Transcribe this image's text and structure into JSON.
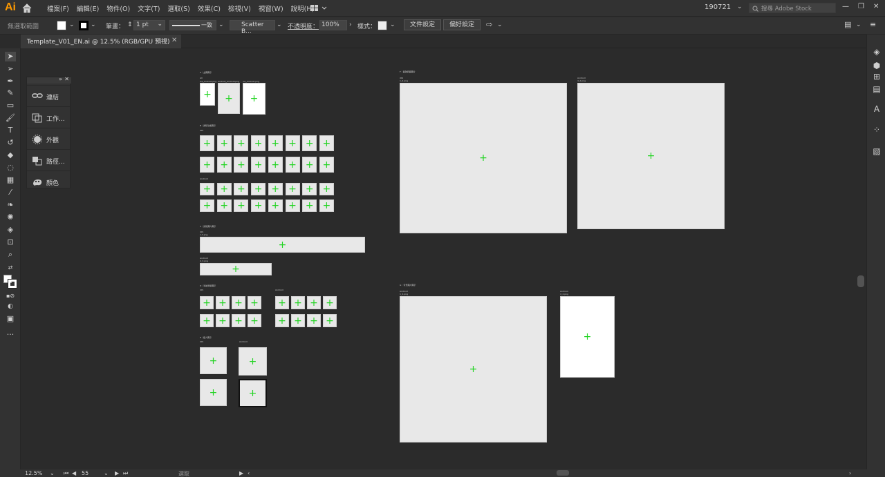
{
  "app": {
    "logo": "Ai",
    "date_badge": "190721",
    "stock_placeholder": "搜尋 Adobe Stock"
  },
  "menu": [
    "檔案(F)",
    "編輯(E)",
    "物件(O)",
    "文字(T)",
    "選取(S)",
    "效果(C)",
    "檢視(V)",
    "視窗(W)",
    "說明(H)"
  ],
  "control": {
    "selection": "無選取範圍",
    "stroke_label": "筆畫：",
    "stroke_weight": "1 pt",
    "stroke_profile": "一致",
    "brush": "Scatter B...",
    "opacity_label": "不透明度：",
    "opacity": "100%",
    "style_label": "樣式：",
    "doc_setup": "文件設定",
    "preferences": "偏好設定"
  },
  "tab": {
    "title": "Template_V01_EN.ai @ 12.5% (RGB/GPU 預視)",
    "close": "✕"
  },
  "panel_items": [
    {
      "label": "連結",
      "icon": "link-icon"
    },
    {
      "label": "工作...",
      "icon": "artboards-icon"
    },
    {
      "label": "外觀",
      "icon": "appearance-icon"
    },
    {
      "label": "路徑...",
      "icon": "pathfinder-icon"
    },
    {
      "label": "顏色",
      "icon": "color-icon"
    }
  ],
  "status": {
    "zoom": "12.5%",
    "artboard": "55",
    "tool": "選取"
  },
  "canvas_labels": {
    "sec_a": "A｜主圖圖示",
    "a_l1": "All",
    "a_l2": "Ios_Android.png",
    "a_l3": "android_Android.png",
    "a_l4": "ios_Android.png",
    "sec_b": "B｜通知功能圖示",
    "b_ios": "iOS",
    "b_android": "Android",
    "sec_c": "C｜通知圖片圖示",
    "c_ios": "iOS",
    "c_ios_s": "1,3,png",
    "c_android": "Android",
    "c_android_s": "4_3.png",
    "sec_d": "D｜導航選單圖示",
    "d_ios": "iOS",
    "d_android": "Android",
    "sec_e": "E｜個人圖示",
    "e_ios": "iOS",
    "e_android": "Android",
    "sec_f": "F｜開啟頁面圖片",
    "f_ios": "iOS",
    "f_ios_s": "1_2.png",
    "f_android": "Android",
    "f_android_s": "4_2.png",
    "sec_g": "G｜背景圖片圖示",
    "g_left": "Android",
    "g_left_s": "1_2.png",
    "g_right": "Android",
    "g_right_s": "4_2.png"
  }
}
